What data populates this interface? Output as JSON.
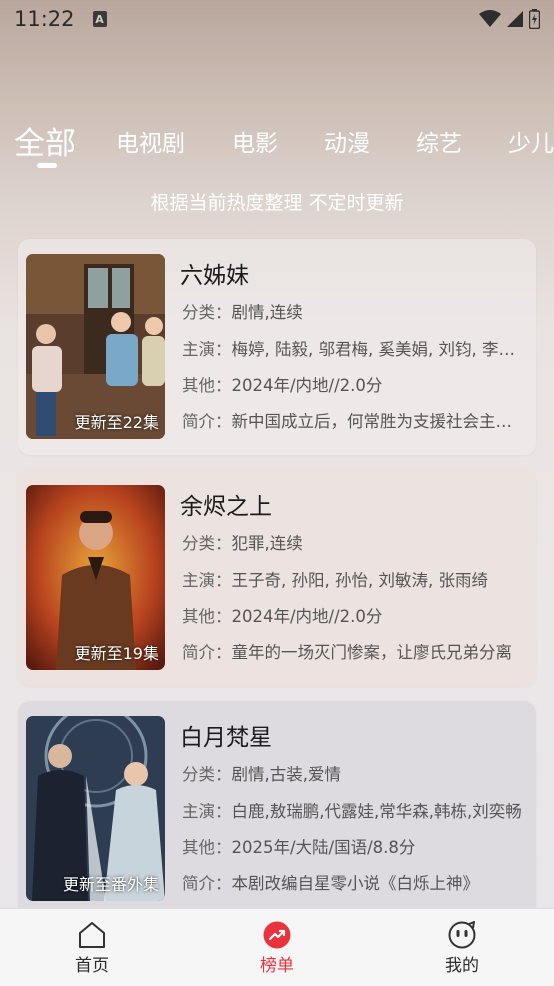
{
  "status": {
    "time": "11:22"
  },
  "tabs": [
    "全部",
    "电视剧",
    "电影",
    "动漫",
    "综艺",
    "少儿"
  ],
  "subtitle": "根据当前热度整理 不定时更新",
  "labels": {
    "category": "分类：",
    "cast": "主演：",
    "other": "其他：",
    "intro": "简介："
  },
  "items": [
    {
      "title": "六姊妹",
      "badge": "更新至22集",
      "category": "剧情,连续",
      "cast": "梅婷, 陆毅, 邬君梅, 奚美娟, 刘钧, 李庚希",
      "other": "2024年/内地//2.0分",
      "intro": "新中国成立后，何常胜为支援社会主义建设"
    },
    {
      "title": "余烬之上",
      "badge": "更新至19集",
      "category": "犯罪,连续",
      "cast": "王子奇, 孙阳, 孙怡, 刘敏涛, 张雨绮",
      "other": "2024年/内地//2.0分",
      "intro": "童年的一场灭门惨案，让廖氏兄弟分离"
    },
    {
      "title": "白月梵星",
      "badge": "更新至番外集",
      "category": "剧情,古装,爱情",
      "cast": "白鹿,敖瑞鹏,代露娃,常华森,韩栋,刘奕畅",
      "other": "2025年/大陆/国语/8.8分",
      "intro": "本剧改编自星零小说《白烁上神》"
    }
  ],
  "nav": {
    "home": "首页",
    "rank": "榜单",
    "mine": "我的"
  },
  "colors": {
    "accent": "#e8333d"
  }
}
